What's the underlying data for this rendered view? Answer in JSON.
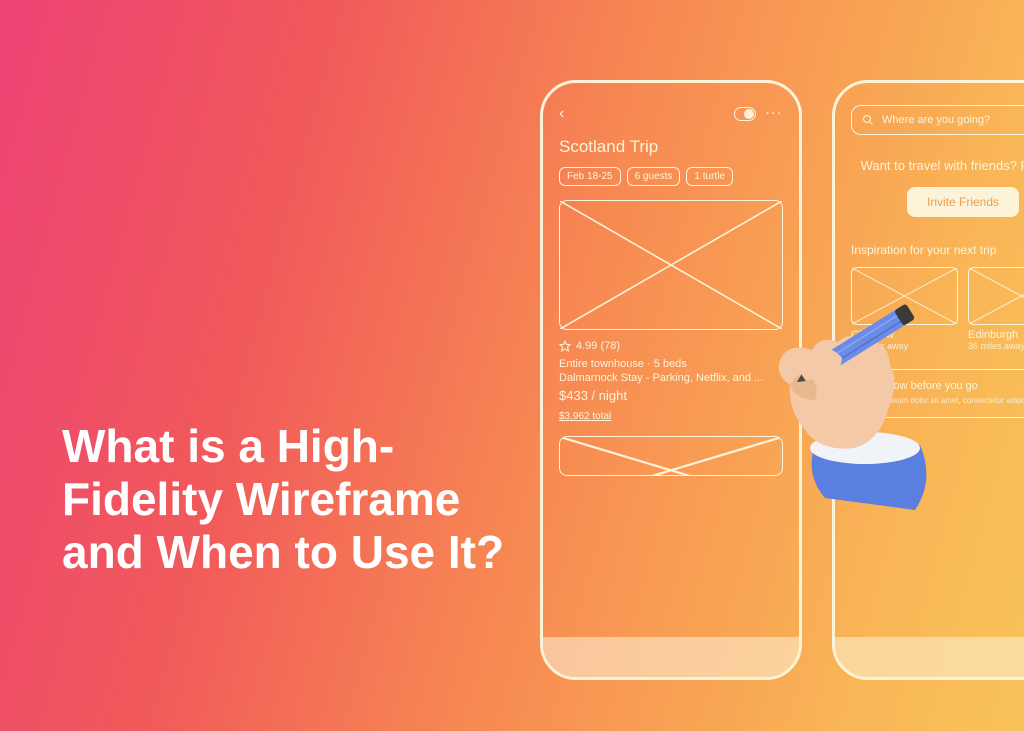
{
  "headline": "What is a High-Fidelity Wireframe and When to Use It?",
  "phone1": {
    "title": "Scotland Trip",
    "chips": [
      "Feb 18-25",
      "6 guests",
      "1 turtle"
    ],
    "rating": "4.99 (78)",
    "line1": "Entire townhouse · 5 beds",
    "line2": "Dalmarnock Stay - Parking, Netflix, and ...",
    "price": "$433 / night",
    "total": "$3,962 total"
  },
  "phone2": {
    "search_placeholder": "Where are you going?",
    "cta_line": "Want to travel with friends? Perfect.",
    "invite": "Invite Friends",
    "section": "Inspiration for your next trip",
    "cards": [
      {
        "title": "Glasgow",
        "sub": "24 miles away"
      },
      {
        "title": "Edinburgh",
        "sub": "36 miles away"
      }
    ],
    "info_title": "Know before you go",
    "info_body": "Lorem ipsum dolor sit amet, consectetur adipis"
  }
}
